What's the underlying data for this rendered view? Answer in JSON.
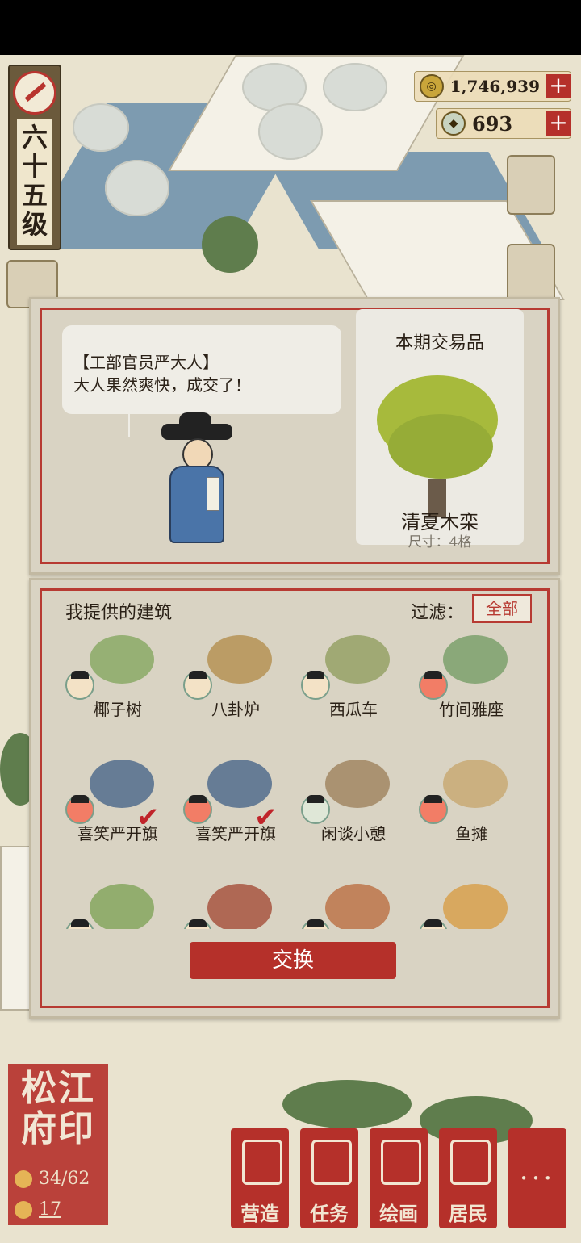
{
  "level": {
    "text": "六十五级"
  },
  "currency": {
    "coins": "1,746,939",
    "gems": "693"
  },
  "dialog": {
    "speaker": "【工部官员严大人】",
    "line": "大人果然爽快，成交了！"
  },
  "trade": {
    "title": "本期交易品",
    "item_name": "清夏木栾",
    "item_size": "尺寸：4格"
  },
  "buildings": {
    "title": "我提供的建筑",
    "filter_label": "过滤：",
    "filter_value": "全部",
    "items": [
      {
        "name": "椰子树",
        "mood": "neutral",
        "selected": false
      },
      {
        "name": "八卦炉",
        "mood": "neutral",
        "selected": false
      },
      {
        "name": "西瓜车",
        "mood": "neutral",
        "selected": false
      },
      {
        "name": "竹间雅座",
        "mood": "happy",
        "selected": false
      },
      {
        "name": "喜笑严开旗",
        "mood": "happy",
        "selected": true
      },
      {
        "name": "喜笑严开旗",
        "mood": "happy",
        "selected": true
      },
      {
        "name": "闲谈小憩",
        "mood": "sad",
        "selected": false
      },
      {
        "name": "鱼摊",
        "mood": "happy",
        "selected": false
      },
      {
        "name": "",
        "mood": "neutral",
        "selected": false
      },
      {
        "name": "",
        "mood": "neutral",
        "selected": false
      },
      {
        "name": "",
        "mood": "neutral",
        "selected": false
      },
      {
        "name": "",
        "mood": "neutral",
        "selected": false
      }
    ],
    "exchange_label": "交换"
  },
  "seal": {
    "text": "松江府印",
    "residents": "34/62",
    "count": "17"
  },
  "bottom_nav": {
    "build": "营造",
    "tasks": "任务",
    "painting": "绘画",
    "residents": "居民",
    "more": "···"
  },
  "colors": {
    "accent_red": "#b5302a",
    "panel_bg": "#d9d3c3"
  }
}
